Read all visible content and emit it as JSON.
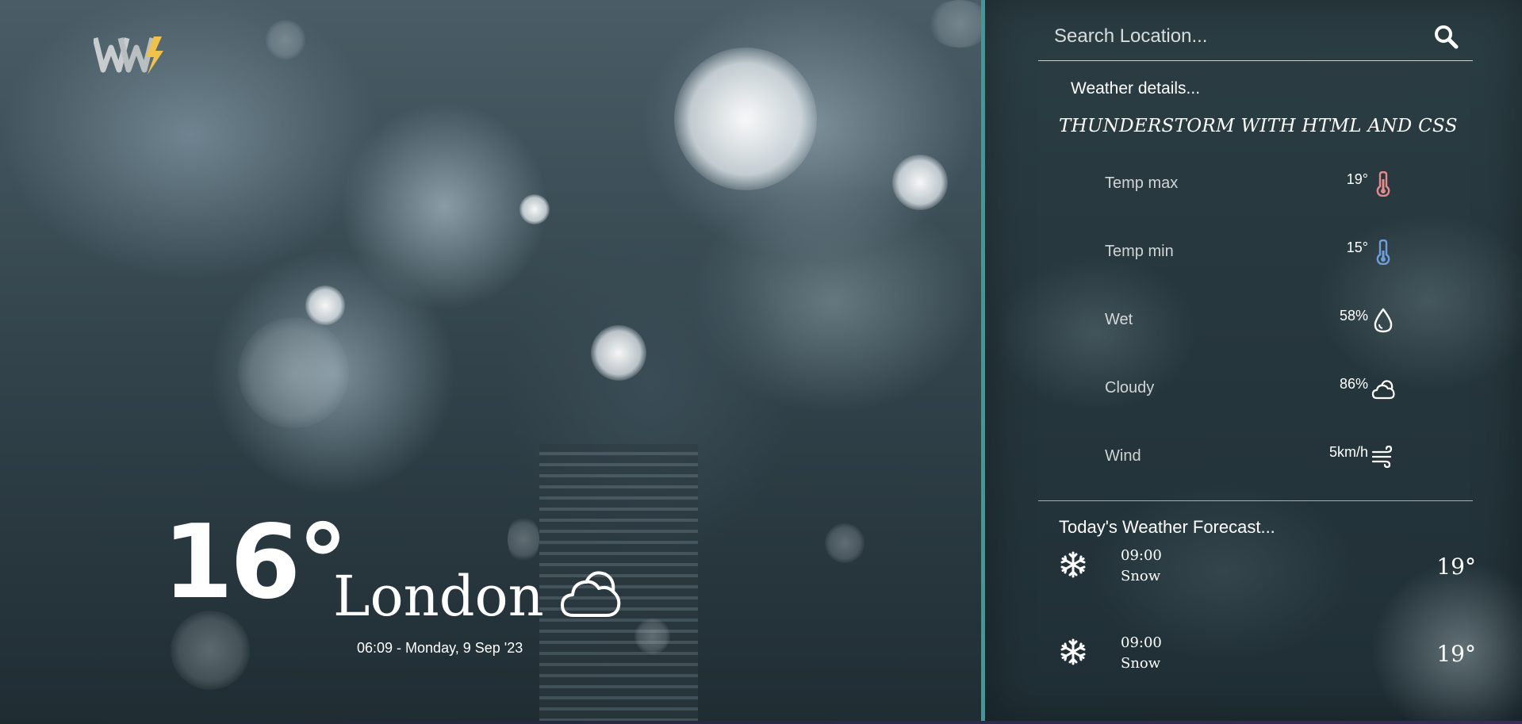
{
  "brand": {
    "logo_text": "WW",
    "accent_color": "#f0c24a"
  },
  "current": {
    "temperature": "16°",
    "city": "London",
    "datetime": "06:09 - Monday, 9 Sep '23",
    "condition_icon": "cloud-icon"
  },
  "search": {
    "placeholder": "Search Location...",
    "icon": "search-icon"
  },
  "details": {
    "heading": "Weather details...",
    "subtitle": "THUNDERSTORM WITH HTML AND CSS",
    "items": [
      {
        "label": "Temp max",
        "value": "19°",
        "icon": "thermometer-hot-icon",
        "icon_color": "#e98a8a"
      },
      {
        "label": "Temp min",
        "value": "15°",
        "icon": "thermometer-cold-icon",
        "icon_color": "#6c9fdc"
      },
      {
        "label": "Wet",
        "value": "58%",
        "icon": "droplet-icon",
        "icon_color": "#ffffff"
      },
      {
        "label": "Cloudy",
        "value": "86%",
        "icon": "cloud-icon",
        "icon_color": "#ffffff"
      },
      {
        "label": "Wind",
        "value": "5km/h",
        "icon": "wind-icon",
        "icon_color": "#ffffff"
      }
    ]
  },
  "forecast": {
    "heading": "Today's Weather Forecast...",
    "items": [
      {
        "time": "09:00",
        "condition": "Snow",
        "temp": "19°",
        "icon": "snowflake-icon"
      },
      {
        "time": "09:00",
        "condition": "Snow",
        "temp": "19°",
        "icon": "snowflake-icon"
      }
    ]
  },
  "colors": {
    "divider": "#3d9a9b",
    "panel_bg": "#25363c"
  }
}
